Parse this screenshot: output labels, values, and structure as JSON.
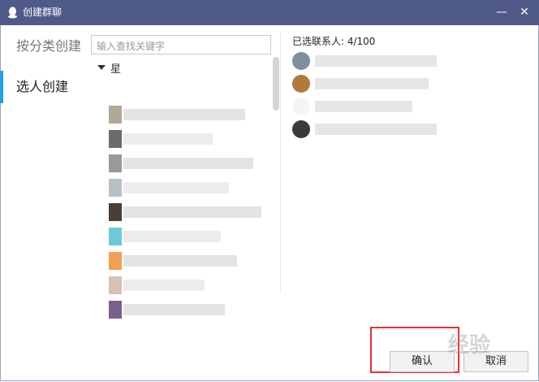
{
  "window": {
    "title": "创建群聊",
    "minimize_label": "—",
    "close_label": "✕",
    "qq_icon": "qq-penguin-icon"
  },
  "nav": {
    "items": [
      {
        "label": "按分类创建",
        "active": false
      },
      {
        "label": "选人创建",
        "active": true
      }
    ]
  },
  "search": {
    "placeholder": "输入查找关键字",
    "value": ""
  },
  "contacts": {
    "group_label": "星",
    "group_expanded": true,
    "rows": [
      {
        "name": "",
        "avatar_color": "#b2a89a"
      },
      {
        "name": "",
        "avatar_color": "#6b6b6b"
      },
      {
        "name": "",
        "avatar_color": "#9a9a9a"
      },
      {
        "name": "",
        "avatar_color": "#b9c0c4"
      },
      {
        "name": "",
        "avatar_color": "#4a3e35"
      },
      {
        "name": "",
        "avatar_color": "#6fc8d8"
      },
      {
        "name": "",
        "avatar_color": "#f0a050"
      },
      {
        "name": "",
        "avatar_color": "#d8c2b4"
      },
      {
        "name": "",
        "avatar_color": "#7a5f8f"
      }
    ]
  },
  "selected": {
    "label": "已选联系人: 4/100",
    "rows": [
      {
        "name": "",
        "avatar_color": "#7f8ea2"
      },
      {
        "name": "",
        "avatar_color": "#b07a3a"
      },
      {
        "name": "",
        "avatar_color": "#f5f5f5"
      },
      {
        "name": "",
        "avatar_color": "#3d3a36"
      }
    ]
  },
  "buttons": {
    "confirm": "确认",
    "cancel": "取消"
  },
  "watermark": "经验",
  "colors": {
    "titlebar": "#4f5a88",
    "accent": "#1ea0e6",
    "highlight": "#e8302f"
  }
}
